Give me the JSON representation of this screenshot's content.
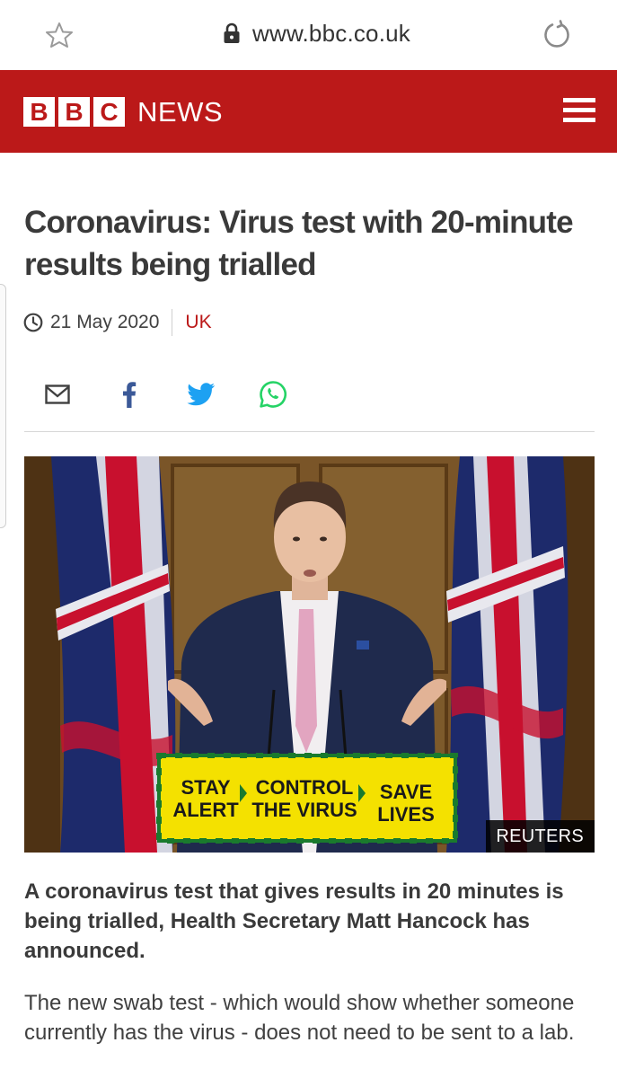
{
  "browser": {
    "url": "www.bbc.co.uk",
    "star_icon": "star-outline-icon",
    "lock_icon": "lock-icon",
    "reload_icon": "reload-icon"
  },
  "header": {
    "logo_letters": [
      "B",
      "B",
      "C"
    ],
    "logo_news": "NEWS",
    "menu_icon": "hamburger-menu-icon",
    "background_color": "#bb1919"
  },
  "article": {
    "headline": "Coronavirus: Virus test with 20-minute results being trialled",
    "date": "21 May 2020",
    "section": "UK",
    "share_icons": [
      "email-icon",
      "facebook-icon",
      "twitter-icon",
      "whatsapp-icon"
    ],
    "image": {
      "credit": "REUTERS",
      "podium_sign": {
        "col1": [
          "STAY",
          "ALERT"
        ],
        "col2": [
          "CONTROL",
          "THE VIRUS"
        ],
        "col3": [
          "SAVE",
          "LIVES"
        ]
      }
    },
    "intro": "A coronavirus test that gives results in 20 minutes is being trialled, Health Secretary Matt Hancock has announced.",
    "paragraph": "The new swab test - which would show whether someone currently has the virus - does not need to be sent to a lab."
  }
}
